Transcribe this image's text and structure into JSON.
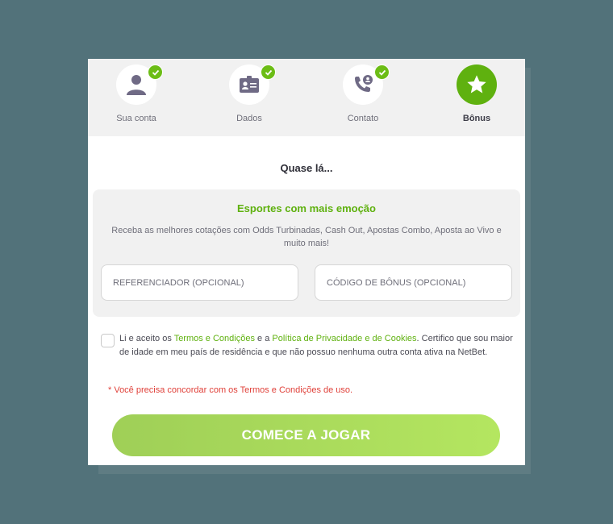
{
  "steps": [
    {
      "label": "Sua conta",
      "icon": "user-icon",
      "done": true
    },
    {
      "label": "Dados",
      "icon": "id-card-icon",
      "done": true
    },
    {
      "label": "Contato",
      "icon": "phone-contact-icon",
      "done": true
    },
    {
      "label": "Bônus",
      "icon": "star-icon",
      "active": true
    }
  ],
  "title": "Quase lá...",
  "promo": {
    "title": "Esportes com mais emoção",
    "description": "Receba as melhores cotações com Odds Turbinadas, Cash Out, Apostas Combo, Aposta ao Vivo e muito mais!"
  },
  "fields": {
    "referrer_placeholder": "REFERENCIADOR (OPCIONAL)",
    "bonus_code_placeholder": "CÓDIGO DE BÔNUS (OPCIONAL)"
  },
  "terms": {
    "part1": "Li e aceito os ",
    "link_terms": "Termos e Condições",
    "part2": " e a ",
    "link_privacy": "Política de Privacidade e de Cookies",
    "part3": ". Certifico que sou maior de idade em meu país de residência e que não possuo nenhuma outra conta ativa na NetBet."
  },
  "error": {
    "prefix": "* Você precisa concordar com os ",
    "link": "Termos e Condições",
    "suffix": " de uso."
  },
  "cta_label": "COMECE A JOGAR",
  "colors": {
    "accent": "#5fb10f",
    "error": "#e0413a",
    "background": "#52727a"
  }
}
